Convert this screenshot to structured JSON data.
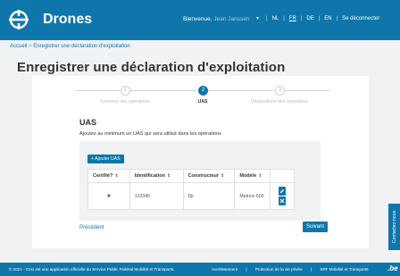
{
  "header": {
    "app_name": "Drones",
    "welcome_label": "Bienvenue,",
    "user_name": "Jean Janssen",
    "caret": "▾",
    "languages": [
      "NL",
      "FR",
      "DE",
      "EN"
    ],
    "active_language": "FR",
    "logout": "Se déconnecter",
    "brand_color": "#0f76ac"
  },
  "breadcrumb": {
    "home": "Accueil",
    "separator": ">",
    "current": "Enregistrer une déclaration d'exploitation"
  },
  "page": {
    "title": "Enregistrer une déclaration d'exploitation"
  },
  "stepper": {
    "steps": [
      {
        "number": "1",
        "label": "Scénario des opérations",
        "state": "done"
      },
      {
        "number": "2",
        "label": "UAS",
        "state": "active"
      },
      {
        "number": "3",
        "label": "Déclarations des opérations",
        "state": "todo"
      }
    ]
  },
  "uas": {
    "title": "UAS",
    "subtitle": "Ajoutez au minimum un UAS qui sera utilisé dans les opérations",
    "add_button": "+ Ajouter UAS",
    "columns": [
      "Certifié?",
      "Identification",
      "Constructeur",
      "Modèle"
    ],
    "sort_icon": "⇕",
    "rows": [
      {
        "certified": "✖",
        "identification": "123345",
        "constructor": "Dji",
        "model": "Matrice 600"
      }
    ],
    "edit_icon": "pencil-icon",
    "delete_icon": "close-icon"
  },
  "nav": {
    "previous": "Précédent",
    "next": "Suivant"
  },
  "side_tab": {
    "label": "Contactez-nous"
  },
  "footer": {
    "text": "© 2021 - Ceci est une application officielle du Service Public Fédéral Mobilité et Transports.",
    "links": [
      "Avertissement",
      "Protection de la vie privée",
      "SPF Mobilité et Transports"
    ],
    "separator": "|",
    "badge": ".be"
  }
}
